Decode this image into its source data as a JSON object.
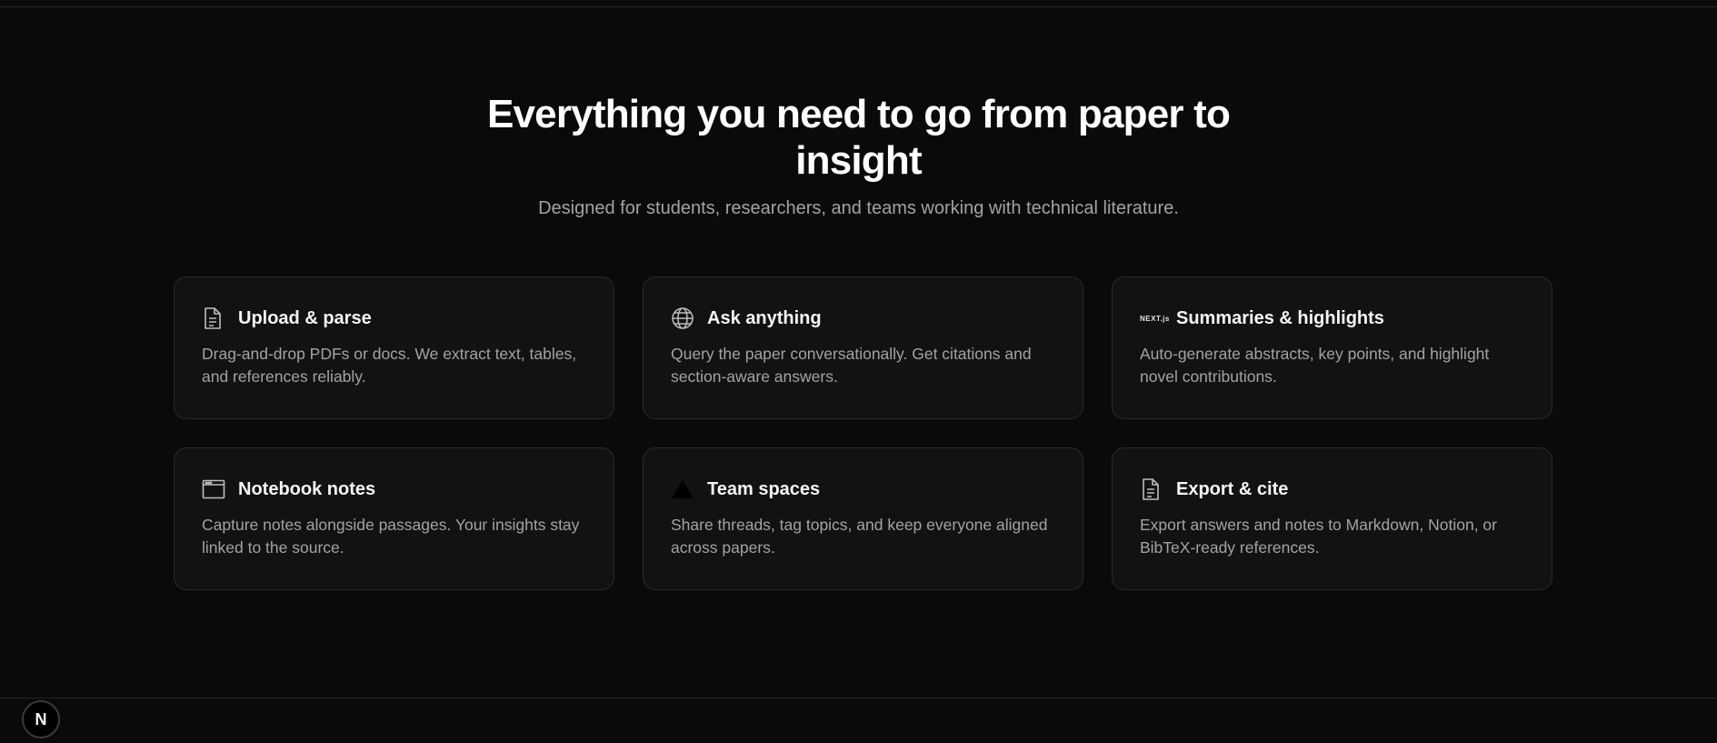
{
  "hero": {
    "title": "Everything you need to go from paper to insight",
    "subtitle": "Designed for students, researchers, and teams working with technical literature."
  },
  "features": [
    {
      "icon": "file-icon",
      "title": "Upload & parse",
      "description": "Drag-and-drop PDFs or docs. We extract text, tables, and references reliably."
    },
    {
      "icon": "globe-icon",
      "title": "Ask anything",
      "description": "Query the paper conversationally. Get citations and section-aware answers."
    },
    {
      "icon": "next-logo-icon",
      "icon_text": "NEXT.js",
      "title": "Summaries & highlights",
      "description": "Auto-generate abstracts, key points, and highlight novel contributions."
    },
    {
      "icon": "window-icon",
      "title": "Notebook notes",
      "description": "Capture notes alongside passages. Your insights stay linked to the source."
    },
    {
      "icon": "vercel-triangle-icon",
      "title": "Team spaces",
      "description": "Share threads, tag topics, and keep everyone aligned across papers."
    },
    {
      "icon": "file-icon",
      "title": "Export & cite",
      "description": "Export answers and notes to Markdown, Notion, or BibTeX-ready references."
    }
  ],
  "dev_badge": {
    "label": "N"
  },
  "colors": {
    "background": "#0a0a0a",
    "card_background": "#121212",
    "card_border": "#2a2a2a",
    "title_text": "#ffffff",
    "muted_text": "#a3a3a3"
  }
}
